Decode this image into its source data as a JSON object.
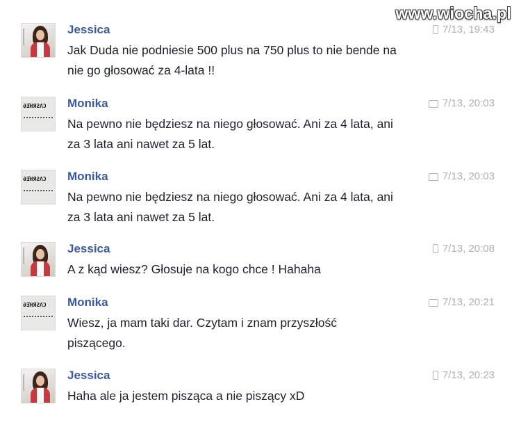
{
  "watermark": "www.wiocha.pl",
  "colors": {
    "name": "#3b5998",
    "timestamp": "#b0b0b0",
    "text": "#1d2129"
  },
  "messages": [
    {
      "author": "Jessica",
      "avatar": "jessica-avatar",
      "source_icon": "phone-icon",
      "time": "7/13, 19:43",
      "lines": [
        "Jak Duda nie podniesie 500 plus na 750 plus to nie bende na",
        "nie go głosować za 4-lata !!"
      ]
    },
    {
      "author": "Monika",
      "avatar": "monika-avatar",
      "source_icon": "chat-icon",
      "time": "7/13, 20:03",
      "lines": [
        "Na pewno nie będziesz na niego głosować. Ani za 4 lata, ani",
        "za 3 lata ani nawet za 5 lat."
      ]
    },
    {
      "author": "Monika",
      "avatar": "monika-avatar",
      "source_icon": "chat-icon",
      "time": "7/13, 20:03",
      "lines": [
        "Na pewno nie będziesz na niego głosować. Ani za 4 lata, ani",
        "za 3 lata ani nawet za 5 lat."
      ]
    },
    {
      "author": "Jessica",
      "avatar": "jessica-avatar",
      "source_icon": "phone-icon",
      "time": "7/13, 20:08",
      "lines": [
        "A z kąd wiesz? Głosuje na kogo chce ! Hahaha"
      ]
    },
    {
      "author": "Monika",
      "avatar": "monika-avatar",
      "source_icon": "chat-icon",
      "time": "7/13, 20:21",
      "lines": [
        "Wiesz, ja mam taki dar. Czytam i znam przyszłość",
        "piszącego."
      ]
    },
    {
      "author": "Jessica",
      "avatar": "jessica-avatar",
      "source_icon": "phone-icon",
      "time": "7/13, 20:23",
      "lines": [
        "Haha ale ja jestem pisząca a nie piszący xD"
      ]
    }
  ]
}
